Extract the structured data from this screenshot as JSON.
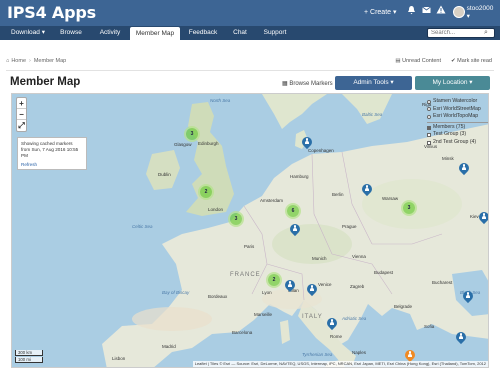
{
  "header": {
    "app_title": "IPS4 Apps",
    "create_label": "+ Create ▾",
    "icons": [
      "bell-icon",
      "mail-icon",
      "warning-icon"
    ],
    "username": "stoo2000 ▾"
  },
  "nav": {
    "items": [
      {
        "label": "Download ▾",
        "name": "nav-download"
      },
      {
        "label": "Browse",
        "name": "nav-browse"
      },
      {
        "label": "Activity",
        "name": "nav-activity"
      },
      {
        "label": "Member Map",
        "name": "nav-member-map",
        "active": true
      },
      {
        "label": "Feedback",
        "name": "nav-feedback"
      },
      {
        "label": "Chat",
        "name": "nav-chat"
      },
      {
        "label": "Support",
        "name": "nav-support"
      }
    ],
    "search_placeholder": "Search..."
  },
  "breadcrumb": {
    "home": "Home",
    "current": "Member Map",
    "unread": "Unread Content",
    "mark_read": "Mark site read"
  },
  "page": {
    "title": "Member Map",
    "browse_markers": "Browse Markers",
    "admin_tools": "Admin Tools ▾",
    "my_location": "My Location ▾"
  },
  "map": {
    "zoom_in": "+",
    "zoom_out": "−",
    "fullscreen": "⤢",
    "cache_notice": "Showing cached markers from Sun, 7 Aug 2016 10:55 PM",
    "refresh": "Refresh",
    "layers": {
      "base": [
        "Stamen Watercolor",
        "Esri WorldStreetMap",
        "Esri WorldTopoMap"
      ],
      "overlays": [
        {
          "label": "Members (75)",
          "checked": true
        },
        {
          "label": "Test Group (3)",
          "checked": false
        },
        {
          "label": "2nd Test Group (4)",
          "checked": false
        }
      ]
    },
    "labels": {
      "countries": [
        {
          "text": "FRANCE",
          "cls": "country"
        },
        {
          "text": "ITALY",
          "cls": "country"
        }
      ],
      "seas": [
        {
          "text": "North Sea",
          "cls": "sea"
        },
        {
          "text": "Baltic Sea",
          "cls": "sea"
        },
        {
          "text": "Celtic Sea",
          "cls": "sea"
        },
        {
          "text": "Bay of Biscay",
          "cls": "sea"
        },
        {
          "text": "Adriatic Sea",
          "cls": "sea"
        },
        {
          "text": "Tyrrhenian Sea",
          "cls": "sea"
        },
        {
          "text": "Black Sea",
          "cls": "sea"
        }
      ],
      "cities": [
        {
          "text": "Glasgow"
        },
        {
          "text": "Edinburgh"
        },
        {
          "text": "Dublin"
        },
        {
          "text": "London"
        },
        {
          "text": "Paris"
        },
        {
          "text": "Amsterdam"
        },
        {
          "text": "Hamburg"
        },
        {
          "text": "Berlin"
        },
        {
          "text": "Copenhagen"
        },
        {
          "text": "Warsaw"
        },
        {
          "text": "Prague"
        },
        {
          "text": "Vienna"
        },
        {
          "text": "Munich"
        },
        {
          "text": "Milan"
        },
        {
          "text": "Rome"
        },
        {
          "text": "Barcelona"
        },
        {
          "text": "Marseille"
        },
        {
          "text": "Lyon"
        },
        {
          "text": "Bordeaux"
        },
        {
          "text": "Madrid"
        },
        {
          "text": "Lisbon"
        },
        {
          "text": "Budapest"
        },
        {
          "text": "Belgrade"
        },
        {
          "text": "Bucharest"
        },
        {
          "text": "Sofia"
        },
        {
          "text": "Minsk"
        },
        {
          "text": "Kiev"
        },
        {
          "text": "Riga"
        },
        {
          "text": "Vilnius"
        },
        {
          "text": "Zagreb"
        },
        {
          "text": "Naples"
        },
        {
          "text": "Venice"
        }
      ]
    },
    "clusters": [
      {
        "count": "3"
      },
      {
        "count": "2"
      },
      {
        "count": "3"
      },
      {
        "count": "6"
      },
      {
        "count": "2"
      },
      {
        "count": "3"
      }
    ],
    "pin_count_blue": 10,
    "pin_count_orange": 1,
    "scale_km": "300 km",
    "scale_mi": "100 mi",
    "attribution": "Leaflet | Tiles © Esri — Source: Esri, DeLorme, NAVTEQ, USGS, Intermap, iPC, NRCAN, Esri Japan, METI, Esri China (Hong Kong), Esri (Thailand), TomTom, 2012"
  }
}
